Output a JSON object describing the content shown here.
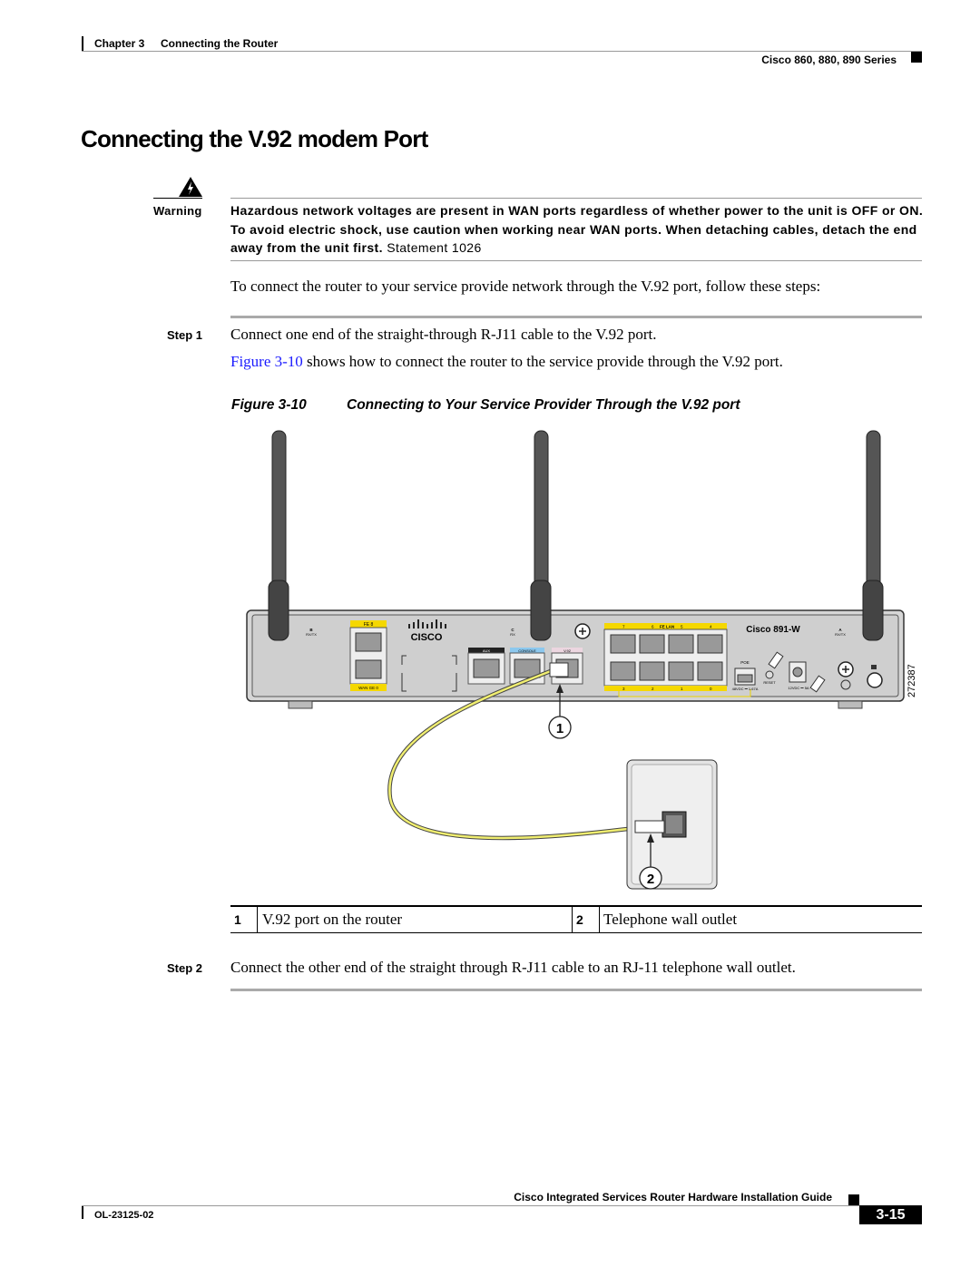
{
  "header": {
    "chapter": "Chapter 3",
    "chapter_title": "Connecting the Router",
    "series": "Cisco 860, 880, 890 Series"
  },
  "title": "Connecting the V.92 modem Port",
  "warning": {
    "label": "Warning",
    "icon": "warning-electric-icon",
    "text_bold": "Hazardous network voltages are present in WAN ports regardless of whether power to the unit is OFF or ON. To avoid electric shock, use caution when working near WAN ports. When detaching cables, detach the end away from the unit first.",
    "statement": "Statement 1026"
  },
  "intro": "To connect the router to your service provide network through the V.92 port, follow these steps:",
  "steps": [
    {
      "label": "Step 1",
      "text": "Connect one end of the straight-through R-J11 cable to the V.92 port.",
      "ref_link": "Figure 3-10",
      "ref_text": " shows how to connect the router to the service provide through the V.92 port."
    },
    {
      "label": "Step 2",
      "text": "Connect the other end of the straight through R-J11 cable to an RJ-11 telephone wall outlet."
    }
  ],
  "figure": {
    "number": "Figure 3-10",
    "caption": "Connecting to Your Service Provider Through the V.92 port",
    "id_number": "272387",
    "router": {
      "model": "Cisco 891-W",
      "brand": "CISCO",
      "labels": {
        "fe8": "FE 8",
        "wan": "WAN GE 0",
        "aux": "AUX",
        "console": "CONSOLE",
        "v92": "V.92",
        "felan": "FE LAN",
        "poe": "POE",
        "reset": "RESET",
        "b": "B",
        "b_sub": "RX/TX",
        "c": "C",
        "c_sub": "RX",
        "a": "A",
        "a_sub": "RX/TX",
        "power48": "48VDC ⎓ 1.67A",
        "power12": "12VDC ⎓ 5A"
      },
      "lan_top": [
        "7",
        "6",
        "5",
        "4"
      ],
      "lan_bottom": [
        "3",
        "2",
        "1",
        "0"
      ]
    },
    "callouts": [
      "1",
      "2"
    ]
  },
  "legend": [
    {
      "num": "1",
      "text": "V.92 port on the router"
    },
    {
      "num": "2",
      "text": "Telephone wall outlet"
    }
  ],
  "footer": {
    "guide": "Cisco Integrated Services Router Hardware Installation Guide",
    "doc_id": "OL-23125-02",
    "page": "3-15"
  }
}
